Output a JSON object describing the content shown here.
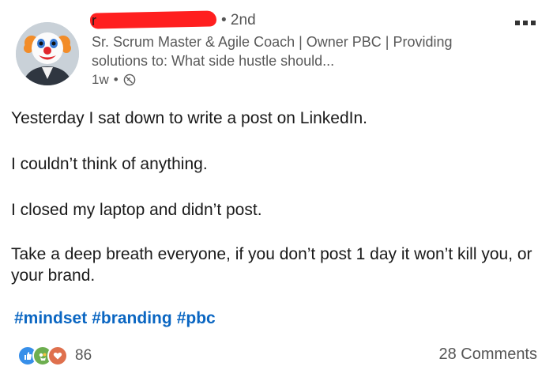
{
  "author": {
    "name_visible": "r",
    "degree": "• 2nd",
    "headline": "Sr. Scrum Master & Agile Coach | Owner PBC | Providing solutions to: What side hustle should...",
    "time": "1w",
    "visibility_separator": "•",
    "visibility_icon": "globe-icon"
  },
  "post": {
    "paragraphs": [
      "Yesterday I sat down to write a post on LinkedIn.",
      "I couldn’t think of anything.",
      "I closed my laptop and didn’t post.",
      "Take a deep breath everyone, if you don’t post 1 day it won’t kill you, or your brand."
    ],
    "hashtags": [
      "#mindset",
      "#branding",
      "#pbc"
    ]
  },
  "social": {
    "reactions": [
      "like-icon",
      "celebrate-icon",
      "love-icon"
    ],
    "reaction_count": "86",
    "comments": "28 Comments"
  },
  "colors": {
    "hashtag": "#0a66c2",
    "redaction": "#ff1f1f",
    "like": "#378fe9",
    "celebrate": "#6dae4f",
    "love": "#df704d"
  }
}
